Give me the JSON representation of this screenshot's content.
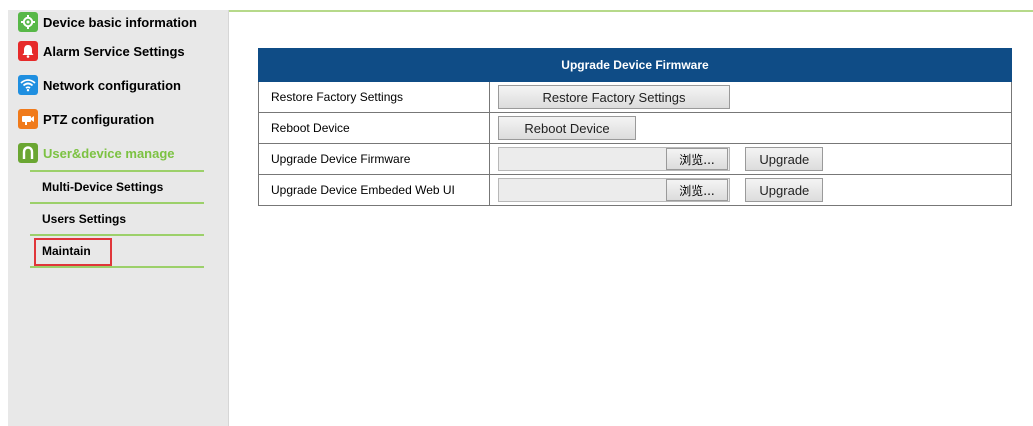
{
  "sidebar": {
    "items": [
      {
        "label": "Device basic information",
        "icon": "gear-icon",
        "color": "#58b848"
      },
      {
        "label": "Alarm Service Settings",
        "icon": "bell-icon",
        "color": "#e62a2a"
      },
      {
        "label": "Network configuration",
        "icon": "wifi-icon",
        "color": "#1f8fe0"
      },
      {
        "label": "PTZ configuration",
        "icon": "ptz-camera-icon",
        "color": "#f07a1a"
      },
      {
        "label": "User&device manage",
        "icon": "user-icon",
        "color": "#6aa632"
      }
    ],
    "subitems": [
      {
        "label": "Multi-Device Settings"
      },
      {
        "label": "Users Settings"
      },
      {
        "label": "Maintain"
      }
    ],
    "active_color": "#7cc242"
  },
  "firmware": {
    "header": "Upgrade Device Firmware",
    "rows": [
      {
        "label": "Restore Factory Settings",
        "button": "Restore Factory Settings"
      },
      {
        "label": "Reboot Device",
        "button": "Reboot Device"
      },
      {
        "label": "Upgrade Device Firmware",
        "browse": "浏览...",
        "button": "Upgrade"
      },
      {
        "label": "Upgrade Device Embeded Web UI",
        "browse": "浏览...",
        "button": "Upgrade"
      }
    ],
    "header_color": "#0f4c86"
  }
}
